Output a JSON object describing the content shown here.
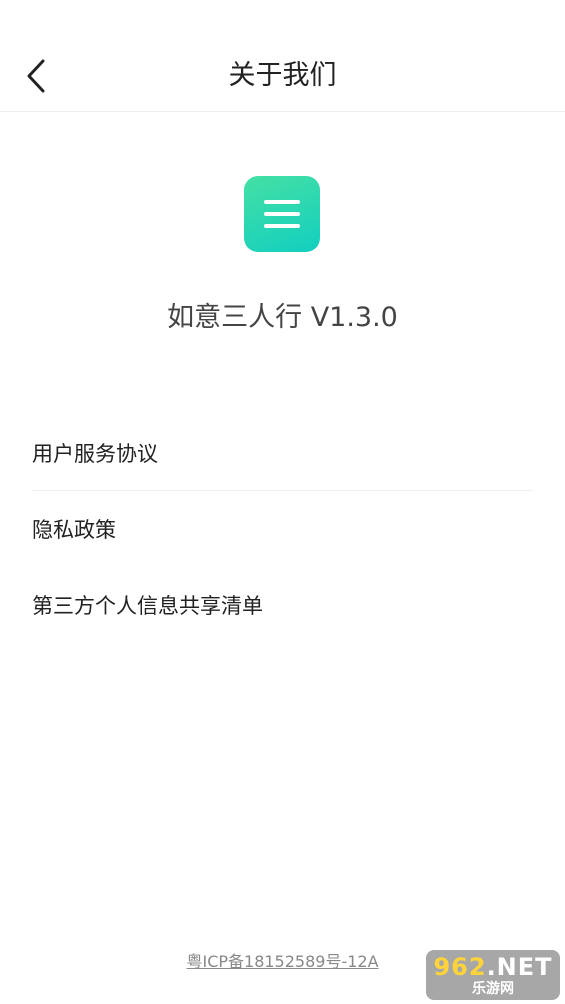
{
  "header": {
    "title": "关于我们",
    "back_icon": "chevron-left-icon"
  },
  "app": {
    "logo_icon": "menu-lines-icon",
    "logo_colors": [
      "#45e0a4",
      "#12cfc0"
    ],
    "name_version": "如意三人行 V1.3.0"
  },
  "menu": {
    "items": [
      {
        "label": "用户服务协议"
      },
      {
        "label": "隐私政策"
      },
      {
        "label": "第三方个人信息共享清单"
      }
    ]
  },
  "footer": {
    "icp": "粤ICP备18152589号-12A"
  },
  "watermark": {
    "top_number": "962",
    "top_suffix": ".NET",
    "bottom": "乐游网"
  }
}
